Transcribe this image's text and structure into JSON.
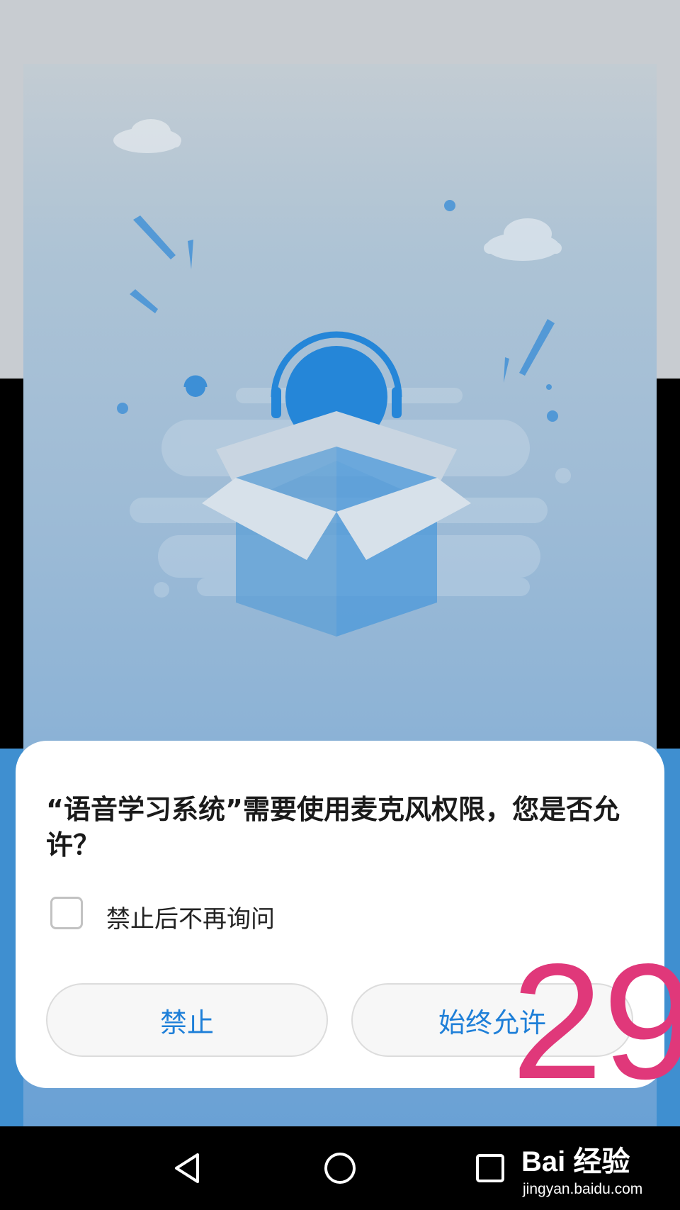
{
  "dialog": {
    "title": "“语音学习系统”需要使用麦克风权限，您是否允许？",
    "checkbox_label": "禁止后不再询问",
    "checkbox_checked": false,
    "deny_label": "禁止",
    "allow_label": "始终允许"
  },
  "overlay": {
    "page_number": "29"
  },
  "watermark": {
    "text": "Bai 经验",
    "url": "jingyan.baidu.com"
  },
  "navigation": {
    "icons": [
      "back-icon",
      "home-icon",
      "recent-apps-icon"
    ]
  },
  "colors": {
    "accent": "#1e7fd8",
    "dialog_bg": "#ffffff",
    "band_blue": "#3f8fd0",
    "page_number": "#e0387a"
  }
}
